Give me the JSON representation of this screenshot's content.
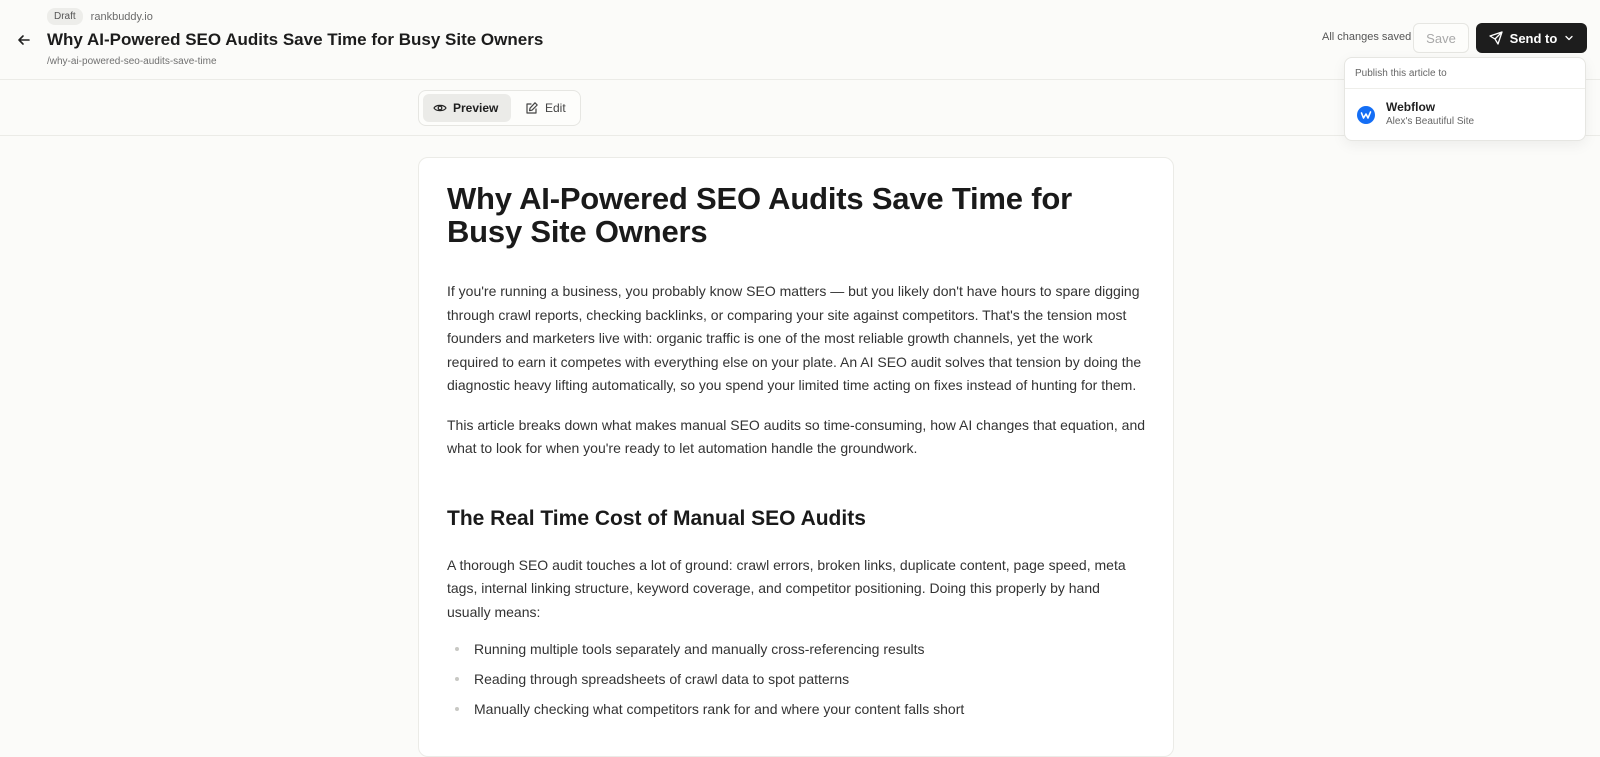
{
  "header": {
    "status_badge": "Draft",
    "site_name": "rankbuddy.io",
    "title": "Why AI-Powered SEO Audits Save Time for Busy Site Owners",
    "slug": "/why-ai-powered-seo-audits-save-time",
    "save_status": "All changes saved",
    "save_label": "Save",
    "send_label": "Send to"
  },
  "publish_menu": {
    "heading": "Publish this article to",
    "items": [
      {
        "name": "Webflow",
        "subtitle": "Alex's Beautiful Site",
        "icon": "webflow-logo-icon",
        "color": "#146ef5"
      }
    ]
  },
  "mode_toggle": {
    "preview_label": "Preview",
    "edit_label": "Edit",
    "active": "preview"
  },
  "article": {
    "title": "Why AI-Powered SEO Audits Save Time for Busy Site Owners",
    "paragraphs": [
      "If you're running a business, you probably know SEO matters — but you likely don't have hours to spare digging through crawl reports, checking backlinks, or comparing your site against competitors. That's the tension most founders and marketers live with: organic traffic is one of the most reliable growth channels, yet the work required to earn it competes with everything else on your plate. An AI SEO audit solves that tension by doing the diagnostic heavy lifting automatically, so you spend your limited time acting on fixes instead of hunting for them.",
      "This article breaks down what makes manual SEO audits so time-consuming, how AI changes that equation, and what to look for when you're ready to let automation handle the groundwork."
    ],
    "section_heading": "The Real Time Cost of Manual SEO Audits",
    "section_paragraph": "A thorough SEO audit touches a lot of ground: crawl errors, broken links, duplicate content, page speed, meta tags, internal linking structure, keyword coverage, and competitor positioning. Doing this properly by hand usually means:",
    "bullets": [
      "Running multiple tools separately and manually cross-referencing results",
      "Reading through spreadsheets of crawl data to spot patterns",
      "Manually checking what competitors rank for and where your content falls short"
    ]
  }
}
